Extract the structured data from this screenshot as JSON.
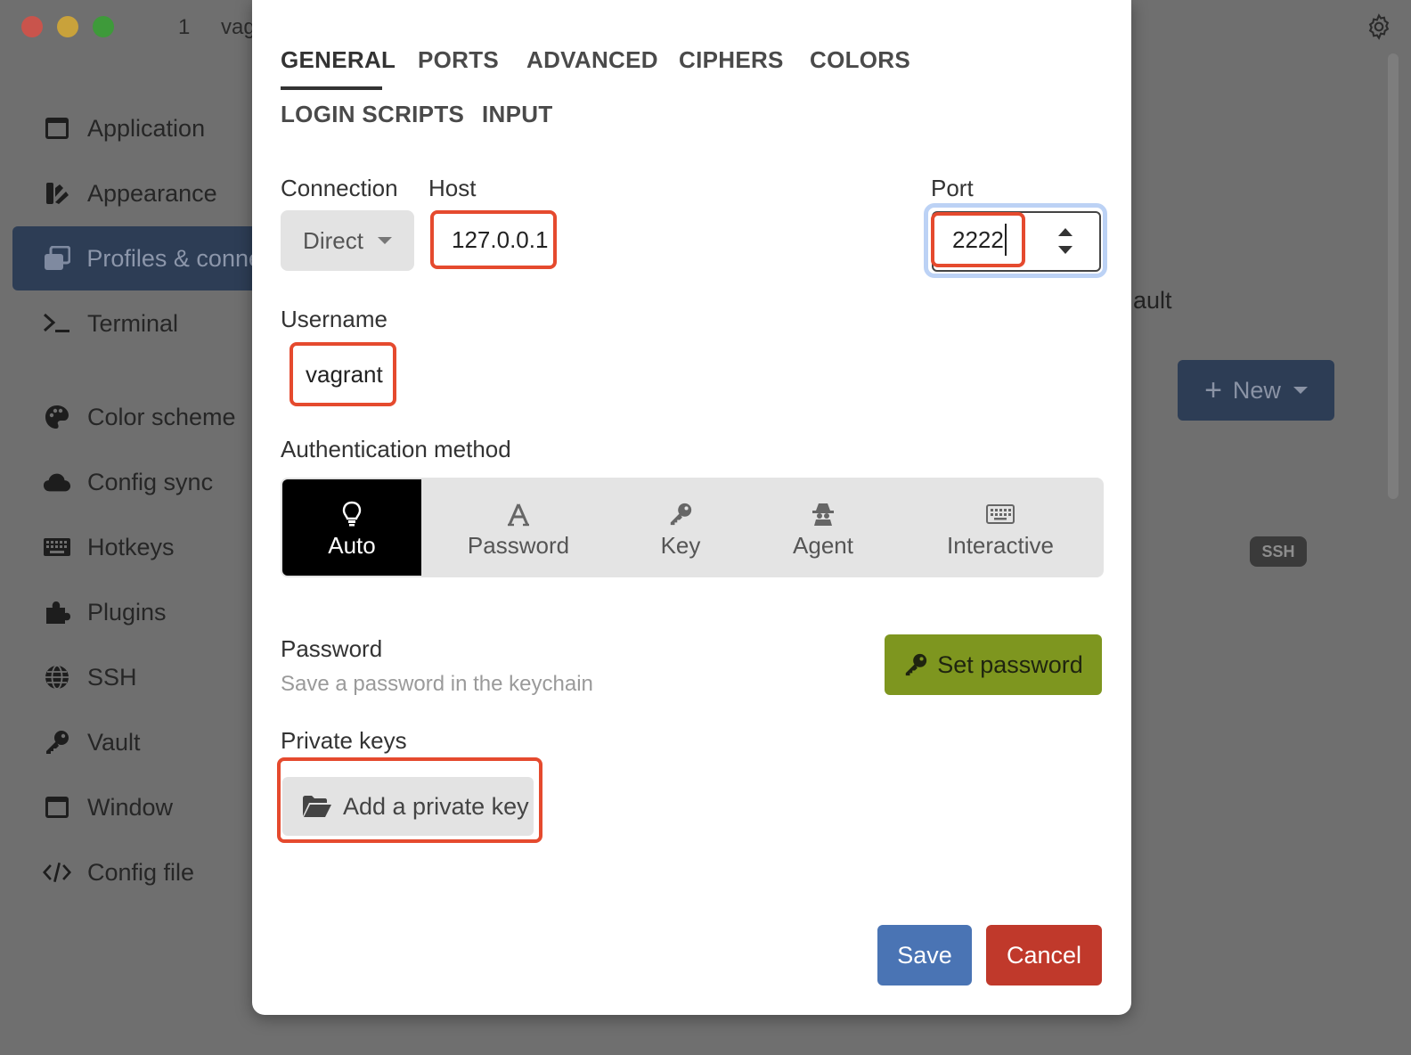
{
  "window": {
    "tab_number": "1",
    "tab_title": "vag",
    "settings_icon": "gear-icon"
  },
  "sidebar": {
    "items": [
      {
        "label": "Application",
        "icon": "window-icon"
      },
      {
        "label": "Appearance",
        "icon": "brush-icon"
      },
      {
        "label": "Profiles & conne",
        "icon": "profiles-icon",
        "active": true
      },
      {
        "label": "Terminal",
        "icon": "terminal-icon"
      },
      {
        "label": "Color scheme",
        "icon": "palette-icon"
      },
      {
        "label": "Config sync",
        "icon": "cloud-icon"
      },
      {
        "label": "Hotkeys",
        "icon": "keyboard-icon"
      },
      {
        "label": "Plugins",
        "icon": "puzzle-icon"
      },
      {
        "label": "SSH",
        "icon": "globe-icon"
      },
      {
        "label": "Vault",
        "icon": "key-icon"
      },
      {
        "label": "Window",
        "icon": "window-icon"
      },
      {
        "label": "Config file",
        "icon": "code-icon"
      }
    ]
  },
  "background": {
    "vault_fragment": "ault",
    "new_button": "New",
    "ssh_badge": "SSH"
  },
  "dialog": {
    "tabs": [
      {
        "label": "GENERAL",
        "active": true
      },
      {
        "label": "PORTS"
      },
      {
        "label": "ADVANCED"
      },
      {
        "label": "CIPHERS"
      },
      {
        "label": "COLORS"
      },
      {
        "label": "LOGIN SCRIPTS"
      },
      {
        "label": "INPUT"
      }
    ],
    "connection": {
      "label": "Connection",
      "value": "Direct"
    },
    "host": {
      "label": "Host",
      "value": "127.0.0.1"
    },
    "port": {
      "label": "Port",
      "value": "2222"
    },
    "username": {
      "label": "Username",
      "value": "vagrant"
    },
    "auth": {
      "label": "Authentication method",
      "options": [
        {
          "label": "Auto",
          "icon": "lightbulb-icon",
          "selected": true
        },
        {
          "label": "Password",
          "icon": "font-a-icon"
        },
        {
          "label": "Key",
          "icon": "key-icon"
        },
        {
          "label": "Agent",
          "icon": "agent-icon"
        },
        {
          "label": "Interactive",
          "icon": "keyboard-icon"
        }
      ]
    },
    "password": {
      "label": "Password",
      "hint": "Save a password in the keychain",
      "button": "Set password"
    },
    "private_keys": {
      "label": "Private keys",
      "button": "Add a private key"
    },
    "save": "Save",
    "cancel": "Cancel"
  },
  "colors": {
    "highlight": "#e54a2e",
    "primary": "#4a74b4",
    "danger": "#c0392b",
    "set_password": "#7e961f",
    "sidebar_active": "#2d3d55"
  }
}
